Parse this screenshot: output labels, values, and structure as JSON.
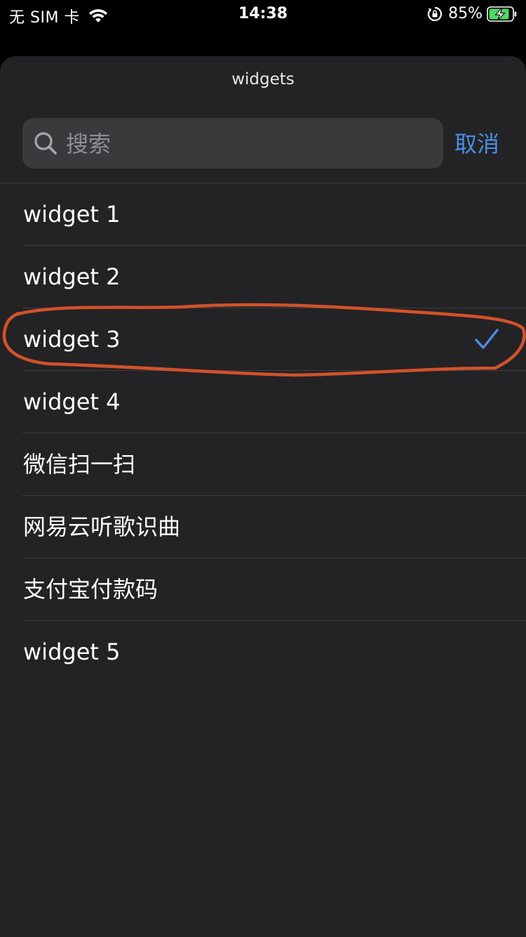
{
  "status_bar": {
    "carrier": "无 SIM 卡",
    "time": "14:38",
    "battery_percent": "85%",
    "icons": [
      "wifi-icon",
      "rotation-lock-icon",
      "battery-charging-icon"
    ]
  },
  "sheet": {
    "title": "widgets",
    "search": {
      "placeholder": "搜索",
      "value": ""
    },
    "cancel_label": "取消",
    "items": [
      {
        "label": "widget 1",
        "selected": false
      },
      {
        "label": "widget 2",
        "selected": false
      },
      {
        "label": "widget 3",
        "selected": true
      },
      {
        "label": "widget 4",
        "selected": false
      },
      {
        "label": "微信扫一扫",
        "selected": false
      },
      {
        "label": "网易云听歌识曲",
        "selected": false
      },
      {
        "label": "支付宝付款码",
        "selected": false
      },
      {
        "label": "widget 5",
        "selected": false
      }
    ]
  },
  "colors": {
    "accent": "#4a8ee6",
    "sheet_background": "#232325",
    "annotation_ring": "#d2522a",
    "battery_fill": "#4cd964"
  }
}
